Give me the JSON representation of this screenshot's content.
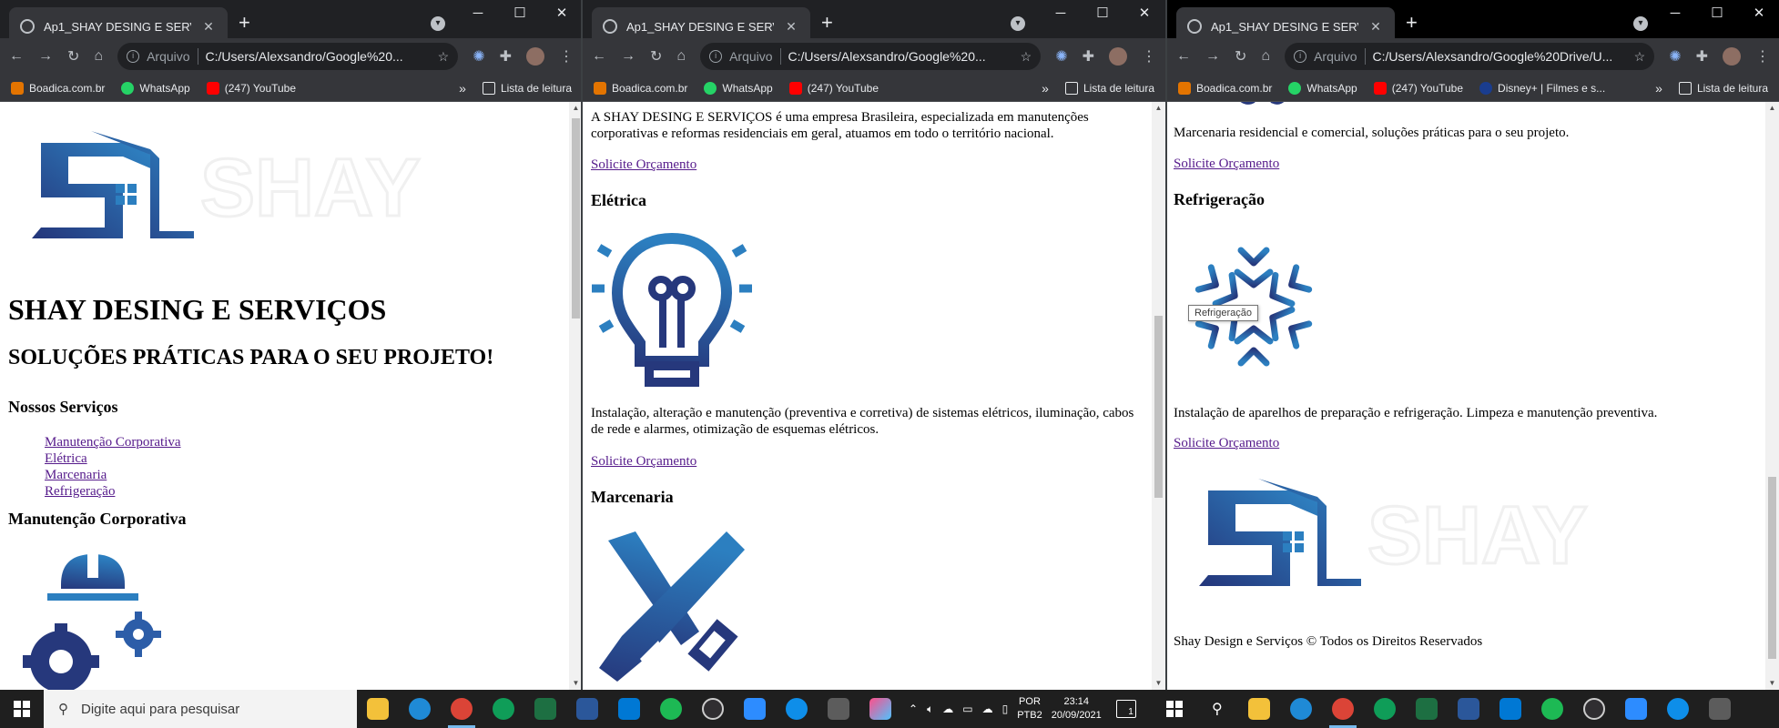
{
  "browser": {
    "tab_title": "Ap1_SHAY DESING E SERVIÇOS",
    "address_prefix": "Arquivo",
    "url_short": "C:/Users/Alexsandro/Google%20...",
    "url_long": "C:/Users/Alexsandro/Google%20Drive/U...",
    "bookmarks": [
      "Boadica.com.br",
      "WhatsApp",
      "(247) YouTube"
    ],
    "bookmark_extra": "Disney+ | Filmes e s...",
    "reading_list": "Lista de leitura",
    "more": "»"
  },
  "page": {
    "site_title": "SHAY DESING E SERVIÇOS",
    "tagline": "SOLUÇÕES PRÁTICAS PARA O SEU PROJETO!",
    "services_heading": "Nossos Serviços",
    "service_links": [
      "Manutenção Corporativa",
      "Elétrica",
      "Marcenaria",
      "Refrigeração"
    ],
    "manutencao_heading": "Manutenção Corporativa",
    "about": "A SHAY DESING E SERVIÇOS é uma empresa Brasileira, especializada em manutenções corporativas e reformas residenciais em geral, atuamos em todo o território nacional.",
    "cta": "Solicite Orçamento",
    "eletrica_heading": "Elétrica",
    "eletrica_text": "Instalação, alteração e manutenção (preventiva e corretiva) de sistemas elétricos, iluminação, cabos de rede e alarmes, otimização de esquemas elétricos.",
    "marcenaria_heading": "Marcenaria",
    "marcenaria_text": "Marcenaria residencial e comercial, soluções práticas para o seu projeto.",
    "refrigeracao_heading": "Refrigeração",
    "refrigeracao_tooltip": "Refrigeração",
    "refrigeracao_text": "Instalação de aparelhos de preparação e refrigeração. Limpeza e manutenção preventiva.",
    "logo_word": "SHAY",
    "footer": "Shay Design e Serviços © Todos os Direitos Reservados"
  },
  "taskbar": {
    "search_placeholder": "Digite aqui para pesquisar",
    "lang_top": "POR",
    "lang_bottom": "PTB2",
    "time": "23:14",
    "date": "20/09/2021",
    "notifications": "1"
  },
  "colors": {
    "logo_dark": "#24357a",
    "logo_light": "#2c7fc0",
    "chrome_dark": "#202124",
    "chrome_toolbar": "#35363a",
    "link": "#551a8b"
  }
}
